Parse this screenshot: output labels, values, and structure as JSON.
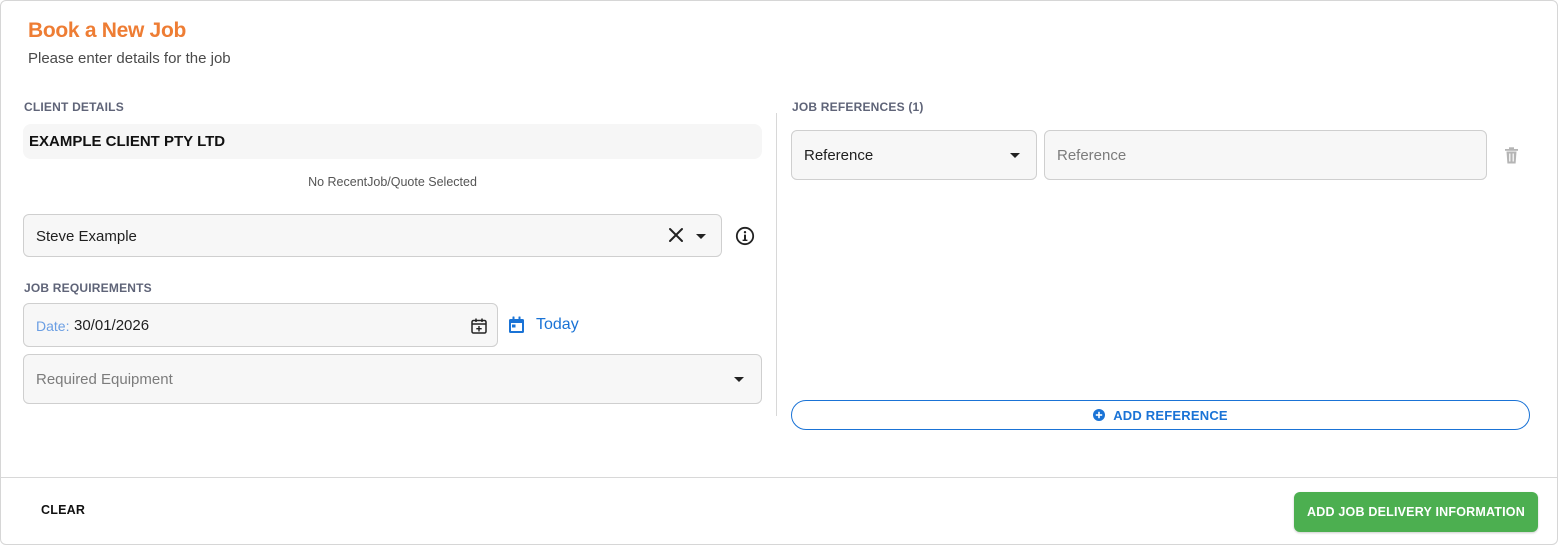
{
  "header": {
    "title": "Book a New Job",
    "subtitle": "Please enter details for the job"
  },
  "client_details": {
    "section_label": "CLIENT DETAILS",
    "client_name": "EXAMPLE CLIENT PTY LTD",
    "recent_note": "No RecentJob/Quote Selected",
    "contact_value": "Steve Example",
    "icons": {
      "clear": "close-icon",
      "dropdown": "chevron-down-icon",
      "info": "info-icon"
    }
  },
  "job_requirements": {
    "section_label": "JOB REQUIREMENTS",
    "date_label": "Date:",
    "date_value": "30/01/2026",
    "today_label": "Today",
    "equipment_placeholder": "Required Equipment",
    "icons": {
      "date_picker": "calendar-plus-icon",
      "today": "calendar-icon"
    }
  },
  "job_references": {
    "section_label": "JOB REFERENCES (1)",
    "rows": [
      {
        "type_value": "Reference",
        "value_placeholder": "Reference"
      }
    ],
    "add_label": "ADD REFERENCE",
    "icons": {
      "delete": "trash-icon",
      "add": "plus-circle-icon"
    }
  },
  "footer": {
    "clear_label": "CLEAR",
    "submit_label": "ADD JOB DELIVERY INFORMATION"
  },
  "colors": {
    "title": "#ee7d34",
    "accent": "#1a73d6",
    "submit": "#4caf50",
    "section_label": "#5f6478"
  }
}
